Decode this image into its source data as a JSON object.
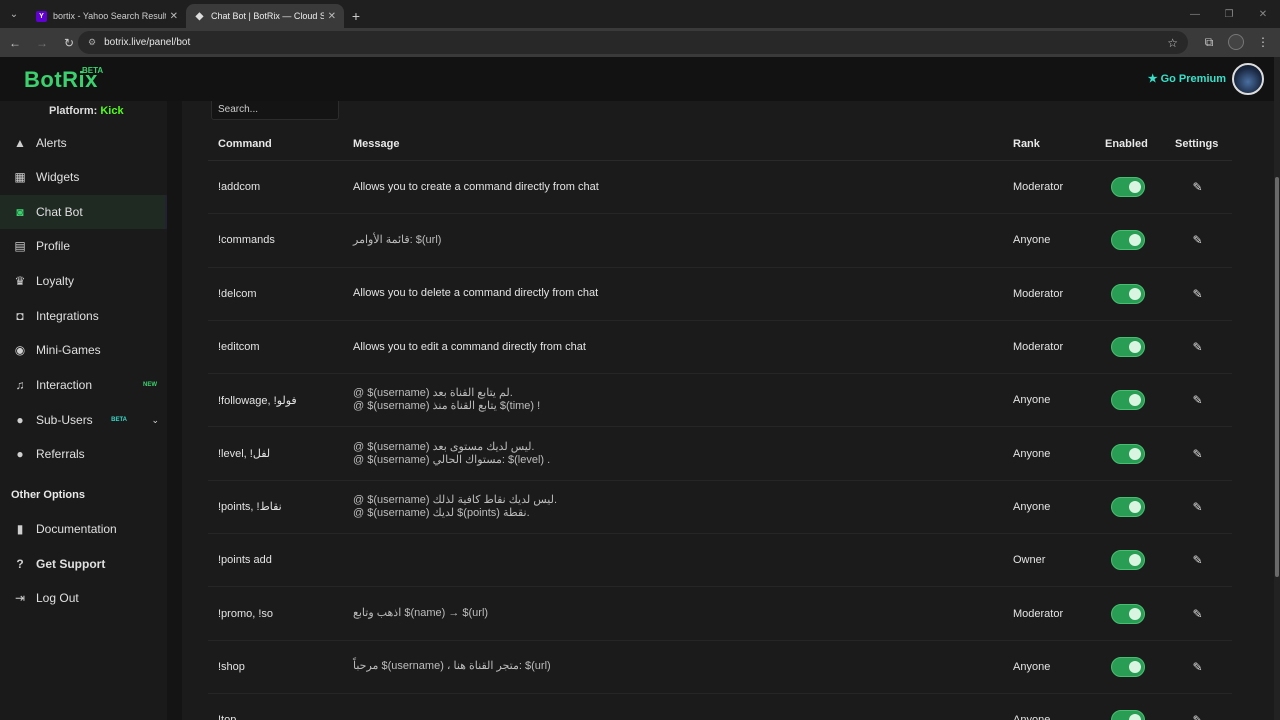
{
  "browser": {
    "tabs": [
      {
        "title": "bortix - Yahoo Search Results",
        "favicon": "Y"
      },
      {
        "title": "Chat Bot | BotRix — Cloud Strea",
        "favicon": "◆"
      }
    ],
    "new_tab": "+",
    "url": "botrix.live/panel/bot"
  },
  "header": {
    "logo": "BotRix",
    "logo_badge": "BETA",
    "premium_label": "Go Premium",
    "premium_color": "#38e0c9"
  },
  "sidebar": {
    "platform_label": "Platform:",
    "platform_value": "Kick",
    "items": [
      {
        "label": "Alerts",
        "icon": "warning-icon",
        "glyph": "▲"
      },
      {
        "label": "Widgets",
        "icon": "widgets-icon",
        "glyph": "▦"
      },
      {
        "label": "Chat Bot",
        "icon": "robot-icon",
        "glyph": "◙"
      },
      {
        "label": "Profile",
        "icon": "id-card-icon",
        "glyph": "▤"
      },
      {
        "label": "Loyalty",
        "icon": "trophy-icon",
        "glyph": "♛"
      },
      {
        "label": "Integrations",
        "icon": "integrations-icon",
        "glyph": "◘"
      },
      {
        "label": "Mini-Games",
        "icon": "gamepad-icon",
        "glyph": "◉"
      },
      {
        "label": "Interaction",
        "icon": "music-icon",
        "glyph": "♫",
        "badge": "NEW"
      },
      {
        "label": "Sub-Users",
        "icon": "users-icon",
        "glyph": "●",
        "badge": "BETA"
      },
      {
        "label": "Referrals",
        "icon": "referrals-icon",
        "glyph": "●"
      }
    ],
    "other_title": "Other Options",
    "other_items": [
      {
        "label": "Documentation",
        "icon": "book-icon",
        "glyph": "▮"
      },
      {
        "label": "Get Support",
        "icon": "question-icon",
        "glyph": "?"
      },
      {
        "label": "Log Out",
        "icon": "logout-icon",
        "glyph": "⇥"
      }
    ]
  },
  "main": {
    "search_placeholder": "Search...",
    "columns": [
      "Command",
      "Message",
      "Rank",
      "Enabled",
      "Settings"
    ],
    "rows": [
      {
        "command": "!addcom",
        "message": [
          "Allows you to create a command directly from chat"
        ],
        "rank": "Moderator",
        "enabled": true
      },
      {
        "command": "!commands",
        "message": [
          "قائمة الأوامر: $(url)"
        ],
        "rank": "Anyone",
        "enabled": true
      },
      {
        "command": "!delcom",
        "message": [
          "Allows you to delete a command directly from chat"
        ],
        "rank": "Moderator",
        "enabled": true
      },
      {
        "command": "!editcom",
        "message": [
          "Allows you to edit a command directly from chat"
        ],
        "rank": "Moderator",
        "enabled": true
      },
      {
        "command": "!followage, !فولو",
        "message": [
          "@ $(username) لم يتابع القناة بعد.",
          "@ $(username) يتابع القناة منذ $(time) !"
        ],
        "rank": "Anyone",
        "enabled": true
      },
      {
        "command": "!level, !لفل",
        "message": [
          "@ $(username) ليس لديك مستوى بعد.",
          "@ $(username) مستواك الحالي: $(level) ."
        ],
        "rank": "Anyone",
        "enabled": true
      },
      {
        "command": "!points, !نقاط",
        "message": [
          "@ $(username) ليس لديك نقاط كافية لذلك.",
          "@ $(username) لديك $(points) نقطة."
        ],
        "rank": "Anyone",
        "enabled": true
      },
      {
        "command": "!points add",
        "message": [
          ""
        ],
        "rank": "Owner",
        "enabled": true
      },
      {
        "command": "!promo, !so",
        "message": [
          "اذهب وتابع $(name) → $(url)"
        ],
        "rank": "Moderator",
        "enabled": true
      },
      {
        "command": "!shop",
        "message": [
          "مرحباً $(username) ، متجر القناة هنا: $(url)"
        ],
        "rank": "Anyone",
        "enabled": true
      },
      {
        "command": "!top",
        "message": [
          ""
        ],
        "rank": "Anyone",
        "enabled": true
      }
    ]
  },
  "colors": {
    "accent": "#3bd16f",
    "kick": "#53fc18",
    "toggle_on": "#2a9d54"
  }
}
